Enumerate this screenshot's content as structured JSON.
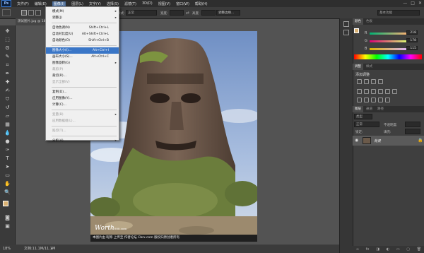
{
  "app": {
    "logo": "Ps"
  },
  "menubar": {
    "items": [
      "文件(F)",
      "编辑(E)",
      "图像(I)",
      "图层(L)",
      "文字(Y)",
      "选择(S)",
      "滤镜(T)",
      "3D(D)",
      "视图(V)",
      "窗口(W)",
      "帮助(H)"
    ],
    "active_index": 2
  },
  "window_controls": {
    "minimize": "—",
    "maximize": "□",
    "close": "✕"
  },
  "options_bar": {
    "style_label": "样式:",
    "style_value": "正常",
    "width_label": "宽度:",
    "height_label": "高度:",
    "refine_edge": "调整边缘...",
    "workspace": "基本功能"
  },
  "document": {
    "tab_title": "测试图片.jpg @ 18.3%..."
  },
  "image_menu": {
    "items": [
      {
        "label": "模式(M)",
        "shortcut": "",
        "submenu": true,
        "disabled": false
      },
      {
        "label": "调整(J)",
        "shortcut": "",
        "submenu": true,
        "disabled": false
      },
      {
        "sep": true
      },
      {
        "label": "自动色调(N)",
        "shortcut": "Shift+Ctrl+L",
        "disabled": false
      },
      {
        "label": "自动对比度(U)",
        "shortcut": "Alt+Shift+Ctrl+L",
        "disabled": false
      },
      {
        "label": "自动颜色(O)",
        "shortcut": "Shift+Ctrl+B",
        "disabled": false
      },
      {
        "sep": true
      },
      {
        "label": "图像大小(I)...",
        "shortcut": "Alt+Ctrl+I",
        "disabled": false,
        "highlighted": true
      },
      {
        "label": "画布大小(S)...",
        "shortcut": "Alt+Ctrl+C",
        "disabled": false
      },
      {
        "label": "图像旋转(G)",
        "shortcut": "",
        "submenu": true,
        "disabled": false
      },
      {
        "label": "裁剪(P)",
        "shortcut": "",
        "disabled": true
      },
      {
        "label": "裁切(R)...",
        "shortcut": "",
        "disabled": false
      },
      {
        "label": "显示全部(V)",
        "shortcut": "",
        "disabled": true
      },
      {
        "sep": true
      },
      {
        "label": "复制(D)...",
        "shortcut": "",
        "disabled": false
      },
      {
        "label": "应用图像(Y)...",
        "shortcut": "",
        "disabled": false
      },
      {
        "label": "计算(C)...",
        "shortcut": "",
        "disabled": false
      },
      {
        "sep": true
      },
      {
        "label": "变量(B)",
        "shortcut": "",
        "submenu": true,
        "disabled": true
      },
      {
        "label": "应用数据组(L)...",
        "shortcut": "",
        "disabled": true
      },
      {
        "sep": true
      },
      {
        "label": "陷印(T)...",
        "shortcut": "",
        "disabled": true
      },
      {
        "sep": true
      },
      {
        "label": "分析(A)",
        "shortcut": "",
        "submenu": true,
        "disabled": false
      }
    ]
  },
  "color_panel": {
    "tabs": [
      "颜色",
      "色板"
    ],
    "r_label": "R",
    "r_value": "218",
    "g_label": "G",
    "g_value": "178",
    "b_label": "B",
    "b_value": "115",
    "foreground_color": "#dab273"
  },
  "adjustments_panel": {
    "tabs": [
      "调整",
      "样式"
    ],
    "title": "添加调整"
  },
  "layers_panel": {
    "tabs": [
      "图层",
      "通道",
      "路径"
    ],
    "kind_label": "类型",
    "blend_mode": "正常",
    "opacity_label": "不透明度:",
    "lock_label": "锁定:",
    "fill_label": "填充:",
    "layer_name": "背景"
  },
  "status_bar": {
    "zoom": "18%",
    "doc_info": "文档:11.1M/11.1M"
  },
  "photo": {
    "watermark_logo": "Worth",
    "watermark_site": "000.com",
    "caption": "本图片由 昵称 上传至 作者论坛 Cbrx.com 版权归原创者所有"
  },
  "colors": {
    "menubar_bg": "#2e2e2e",
    "panel_bg": "#3f3f3f",
    "workspace_bg": "#535353",
    "menu_highlight": "#3a76c7"
  }
}
